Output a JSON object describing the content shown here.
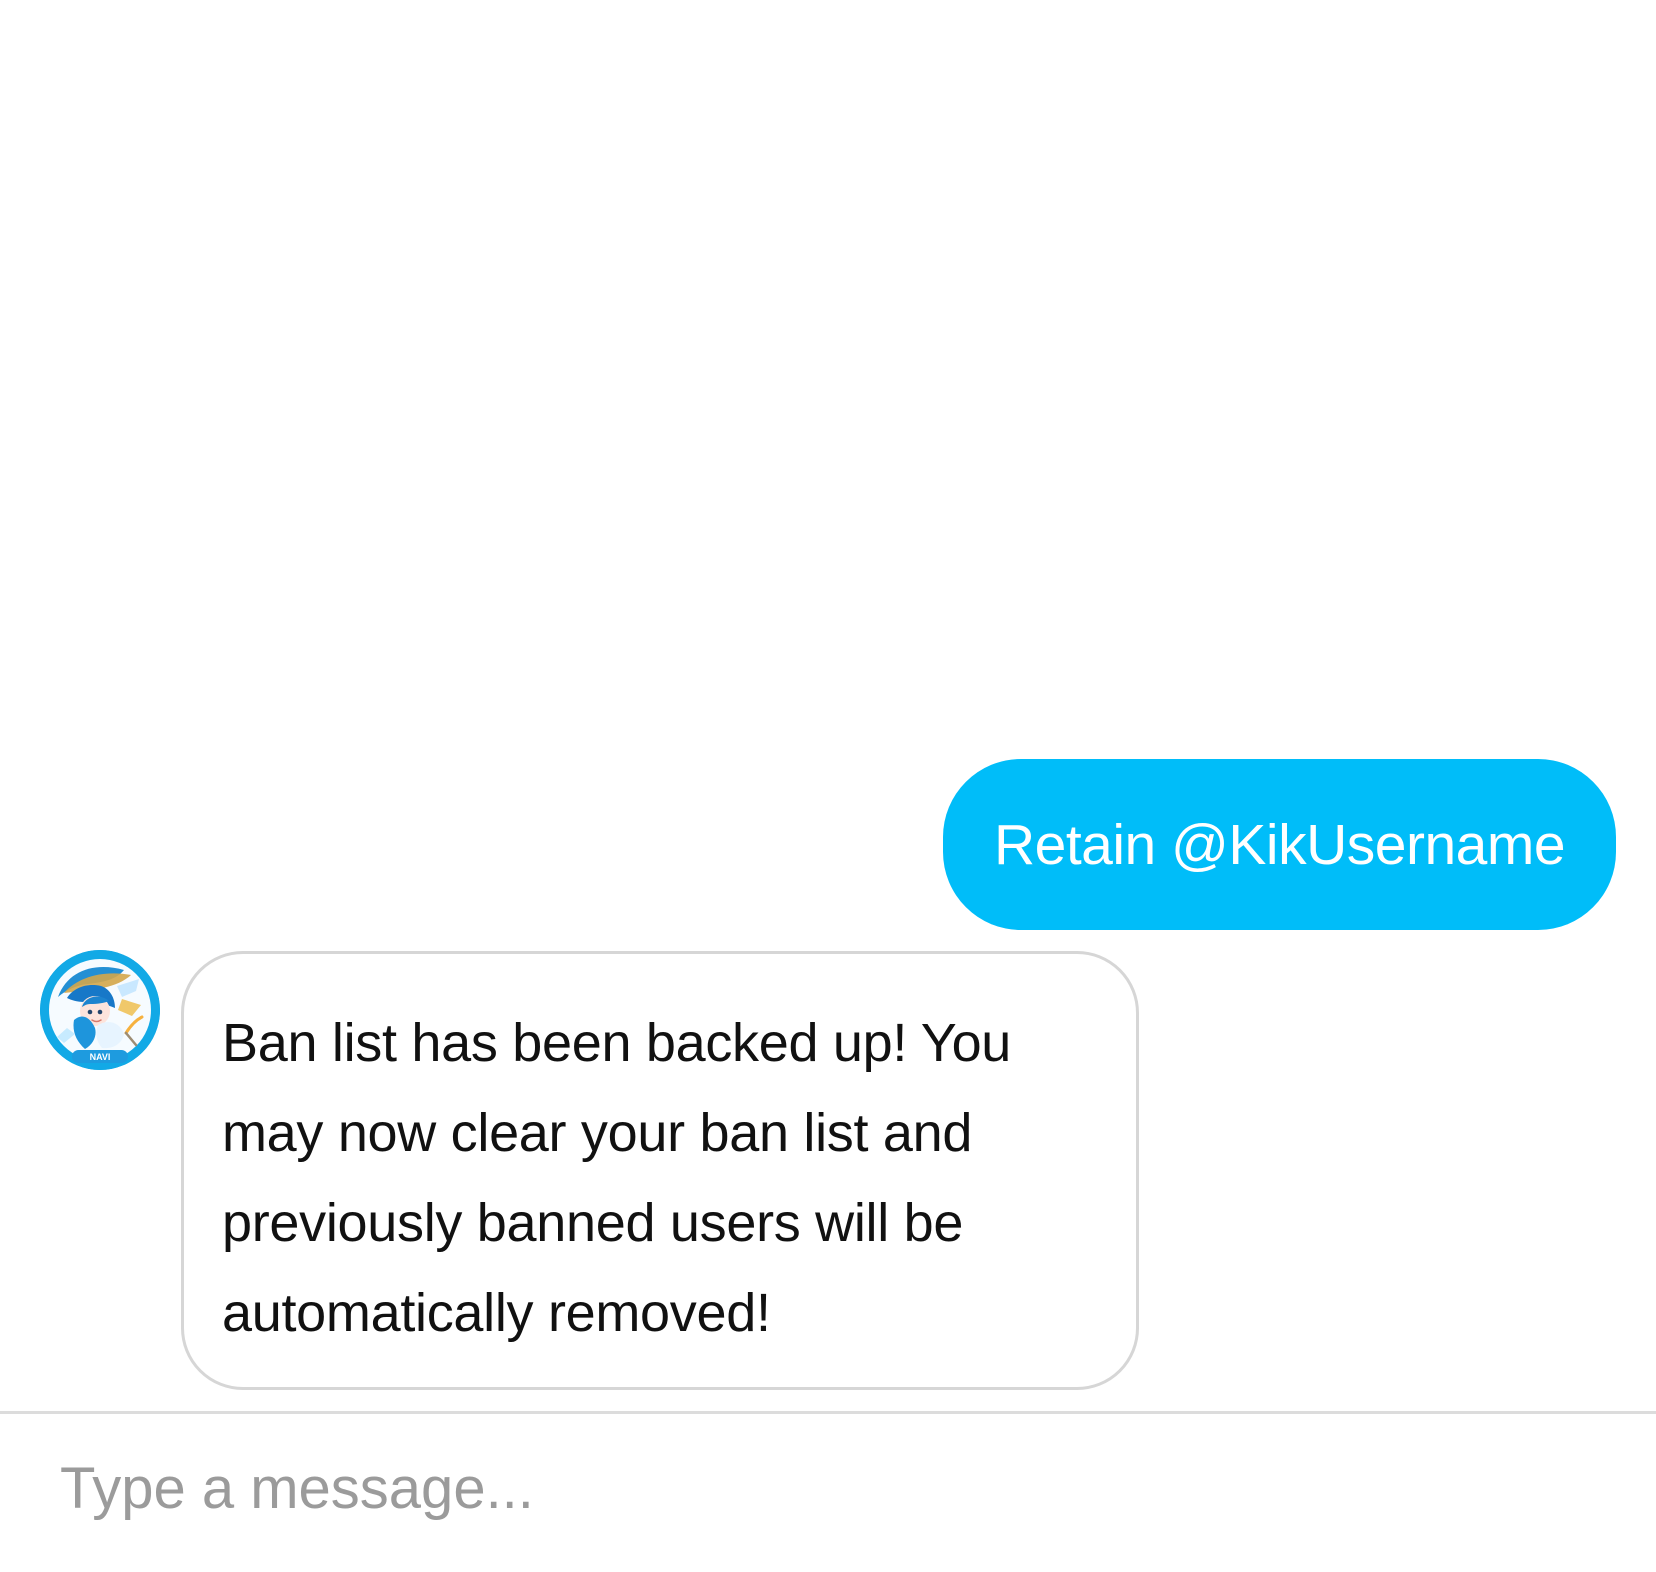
{
  "conversation": {
    "messages": [
      {
        "direction": "outgoing",
        "text": "Retain @KikUsername"
      },
      {
        "direction": "incoming",
        "avatar_icon": "bot-avatar-icon",
        "avatar_label": "NAVI",
        "text": "Ban list has been backed up! You may now clear your ban list and previously banned users will be automatically removed!"
      }
    ]
  },
  "composer": {
    "placeholder": "Type a message..."
  },
  "colors": {
    "outgoing_bubble": "#00bdf9",
    "incoming_border": "#d6d6d6",
    "avatar_ring": "#12a9e6",
    "placeholder": "#9b9b9b"
  }
}
